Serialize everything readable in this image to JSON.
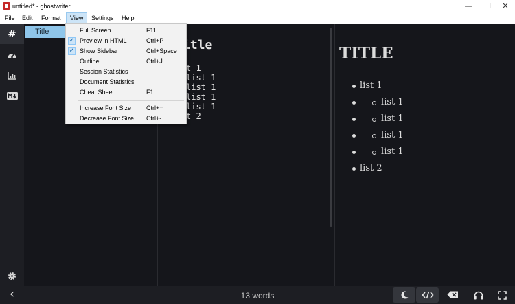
{
  "window": {
    "title": "untitled* - ghostwriter",
    "minimize": "—",
    "maximize": "☐",
    "close": "✕"
  },
  "menubar": {
    "items": [
      "File",
      "Edit",
      "Format",
      "View",
      "Settings",
      "Help"
    ],
    "active": "View"
  },
  "view_menu": {
    "items": [
      {
        "label": "Full Screen",
        "shortcut": "F11",
        "checked": false
      },
      {
        "label": "Preview in HTML",
        "shortcut": "Ctrl+P",
        "checked": true
      },
      {
        "label": "Show Sidebar",
        "shortcut": "Ctrl+Space",
        "checked": true
      },
      {
        "label": "Outline",
        "shortcut": "Ctrl+J",
        "checked": false
      },
      {
        "label": "Session Statistics",
        "shortcut": "",
        "checked": false
      },
      {
        "label": "Document Statistics",
        "shortcut": "",
        "checked": false
      },
      {
        "label": "Cheat Sheet",
        "shortcut": "F1",
        "checked": false
      },
      {
        "label": "Increase Font Size",
        "shortcut": "Ctrl+=",
        "checked": false
      },
      {
        "label": "Decrease Font Size",
        "shortcut": "Ctrl+-",
        "checked": false
      }
    ],
    "check_glyph": "✓"
  },
  "rail": {
    "icons": [
      "hash-icon",
      "gauge-icon",
      "bar-chart-icon",
      "markdown-icon",
      "gear-icon"
    ],
    "hash_glyph": "#"
  },
  "outline": {
    "items": [
      "Title"
    ]
  },
  "editor": {
    "heading": "itle",
    "lines": [
      "t 1",
      "list 1",
      "list 1",
      "list 1",
      "list 1",
      "t 2"
    ]
  },
  "preview": {
    "heading": "TITLE",
    "items": [
      {
        "text": "list 1",
        "level": 0
      },
      {
        "text": "list 1",
        "level": 1
      },
      {
        "text": "list 1",
        "level": 1
      },
      {
        "text": "list 1",
        "level": 1
      },
      {
        "text": "list 1",
        "level": 1
      },
      {
        "text": "list 2",
        "level": 0
      }
    ]
  },
  "status": {
    "word_count": "13 words",
    "collapse_glyph": "‹"
  },
  "colors": {
    "background": "#15161b",
    "sidebar_highlight": "#8fc6ea",
    "menu_active": "#cce4f7"
  }
}
